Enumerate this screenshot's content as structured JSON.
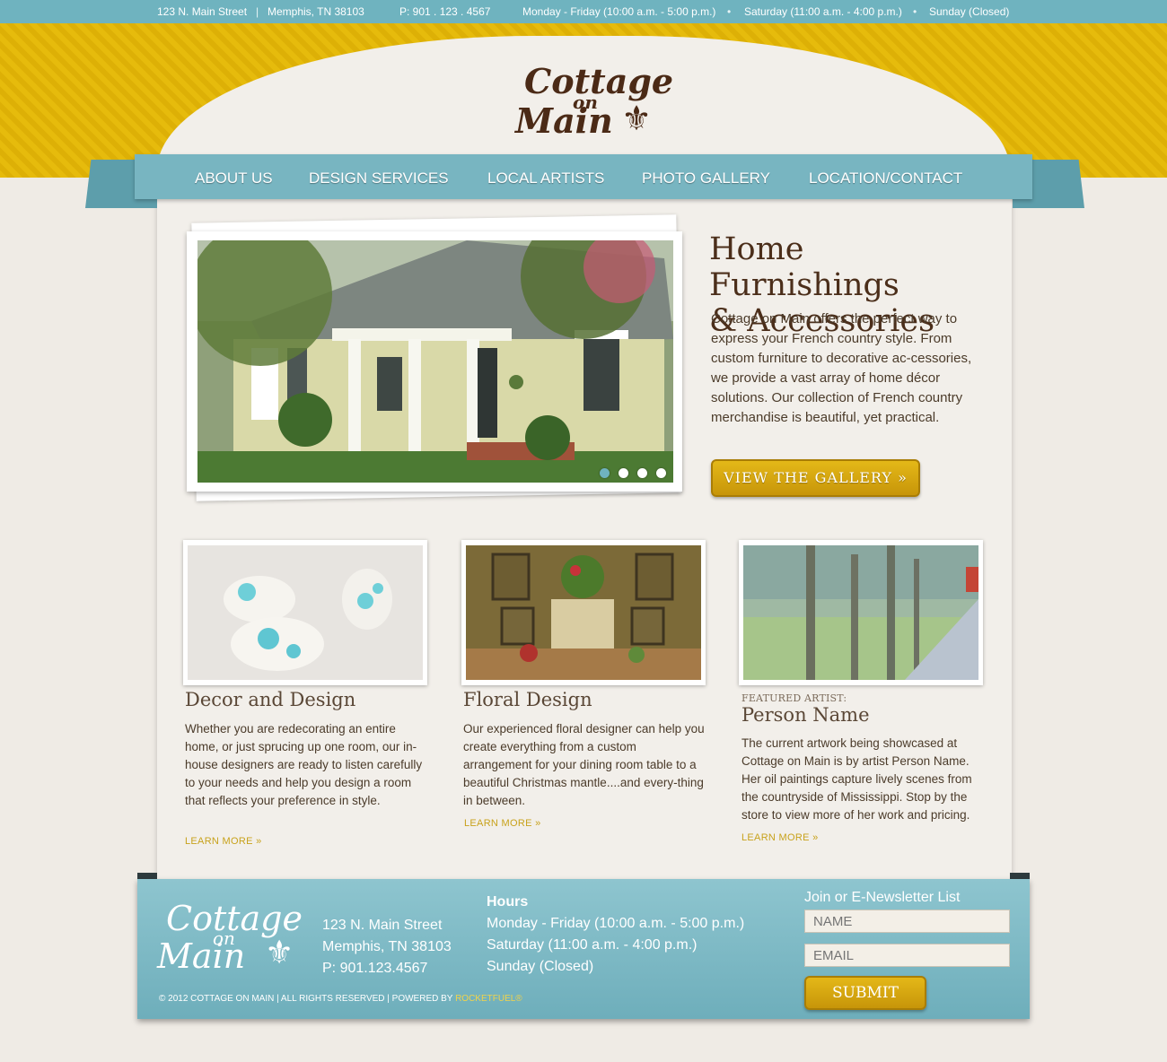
{
  "topbar": {
    "address": "123 N. Main Street",
    "city": "Memphis, TN 38103",
    "phone": "P: 901 . 123 . 4567",
    "hours_weekday": "Monday - Friday (10:00 a.m. - 5:00 p.m.)",
    "hours_saturday": "Saturday (11:00 a.m. - 4:00 p.m.)",
    "hours_sunday": "Sunday (Closed)",
    "separator": "|",
    "bullet": "•"
  },
  "logo": {
    "line1": "Cottage",
    "line2": "on",
    "line3": "Main",
    "glyph": "⚜"
  },
  "nav": {
    "items": [
      "ABOUT US",
      "DESIGN SERVICES",
      "LOCAL ARTISTS",
      "PHOTO GALLERY",
      "LOCATION/CONTACT"
    ]
  },
  "hero": {
    "title_line1": "Home Furnishings",
    "title_line2": "& Accessories",
    "text": "Cottage on Main offers the perfect way to express your French country style. From custom furniture to decorative ac-cessories, we provide a vast array of home décor solutions.  Our collection of French country merchandise is beautiful, yet practical.",
    "button": "VIEW THE GALLERY  »",
    "slides": 4,
    "active_slide": 1
  },
  "cards": [
    {
      "title": "Decor and Design",
      "text": "Whether you are redecorating an entire home, or just sprucing up one room, our in-house designers are ready to listen carefully to your needs and help you design a room that reflects your preference in style.",
      "link": "LEARN MORE »"
    },
    {
      "title": "Floral Design",
      "text": "Our experienced floral designer can help you create everything from a custom arrangement for your dining room table to a beautiful Christmas mantle....and every-thing in between.",
      "link": "LEARN MORE »"
    },
    {
      "label": "FEATURED ARTIST:",
      "title": "Person Name",
      "text": "The current artwork being showcased at Cottage on Main is by artist Person Name. Her oil paintings capture lively scenes from the countryside of Mississippi. Stop by the store to view more of her work and pricing.",
      "link": "LEARN MORE »"
    }
  ],
  "footer": {
    "address1": "123 N. Main Street",
    "address2": "Memphis, TN 38103",
    "phone": "P: 901.123.4567",
    "hours_title": "Hours",
    "hours1": "Monday - Friday (10:00 a.m. - 5:00 p.m.)",
    "hours2": "Saturday (11:00 a.m. - 4:00 p.m.)",
    "hours3": "Sunday (Closed)",
    "newsletter_title": "Join or E-Newsletter List",
    "name_placeholder": "NAME",
    "email_placeholder": "EMAIL",
    "submit": "SUBMIT",
    "copyright": "© 2012 COTTAGE ON MAIN   |   ALL RIGHTS RESERVED   |   POWERED BY ",
    "powered": "ROCKETFUEL®"
  },
  "colors": {
    "teal": "#78b5c1",
    "gold": "#e4b818",
    "brown": "#4b2a16",
    "cream": "#f2efea"
  }
}
